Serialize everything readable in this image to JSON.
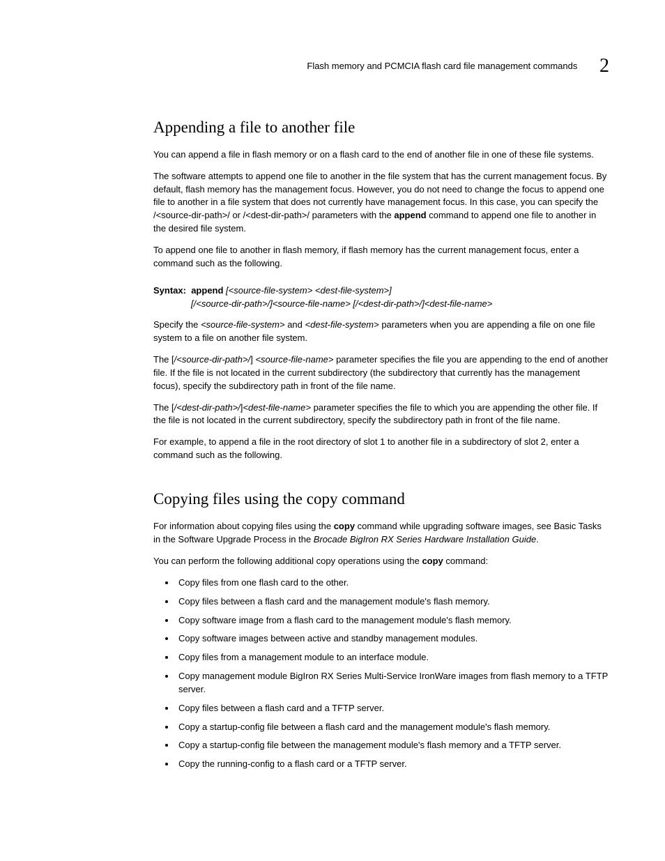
{
  "header": {
    "title": "Flash memory and PCMCIA flash card file management commands",
    "chapter": "2"
  },
  "s1": {
    "heading": "Appending a file to another file",
    "p1": "You can append a file in flash memory or on a flash card to the end of another file in one of these file systems.",
    "p2a": "The software attempts to append one file to another in the file system that has the current management focus. By default, flash memory has the management focus. However, you do not need to change the focus to append one file to another in a file system that does not currently have management focus. In this case, you can specify the /<source-dir-path>/ or /<dest-dir-path>/ parameters with the ",
    "p2b": "append",
    "p2c": " command to append one file to another in the desired file system.",
    "p3": "To append one file to another in flash memory, if flash memory has the current management focus, enter a command such as the following.",
    "syntax_label": "Syntax:",
    "syntax_cmd": "append",
    "syntax_args1": " [<source-file-system> <dest-file-system>]",
    "syntax_args2": "[/<source-dir-path>/]<source-file-name> [/<dest-dir-path>/]<dest-file-name>",
    "p4a": "Specify the ",
    "p4b": "<source-file-system>",
    "p4c": " and ",
    "p4d": "<dest-file-system>",
    "p4e": " parameters when you are appending a file on one file system to a file on another file system.",
    "p5a": "The [",
    "p5b": "/<source-dir-path>/",
    "p5c": "] ",
    "p5d": "<source-file-name>",
    "p5e": " parameter specifies the file you are appending to the end of another file. If the file is not located in the current subdirectory (the subdirectory that currently has the management focus), specify the subdirectory path in front of the file name.",
    "p6a": "The [",
    "p6b": "/<dest-dir-path>/",
    "p6c": "]",
    "p6d": "<dest-file-name>",
    "p6e": " parameter specifies the file to which you are appending the other file. If the file is not located in the current subdirectory, specify the subdirectory path in front of the file name.",
    "p7": "For example, to append a file in the root directory of slot 1 to another file in a subdirectory of slot 2, enter a command such as the following."
  },
  "s2": {
    "heading": "Copying files using the copy command",
    "p1a": "For information about copying files using the ",
    "p1b": "copy",
    "p1c": " command while upgrading software images, see Basic Tasks in the Software Upgrade Process in the ",
    "p1d": "Brocade BigIron RX Series Hardware Installation Guide",
    "p1e": ".",
    "p2a": "You can perform the following additional copy operations using the ",
    "p2b": "copy",
    "p2c": " command:",
    "bullets": [
      "Copy files from one flash card to the other.",
      "Copy files between a flash card and the management module's flash memory.",
      "Copy software image from a flash card to the management module's flash memory.",
      "Copy software images between active and standby management modules.",
      "Copy files from a management module to an interface module.",
      "Copy management module BigIron RX Series Multi-Service IronWare images from flash memory to a TFTP server.",
      "Copy files between a flash card and a TFTP server.",
      "Copy a startup-config file between a flash card and the management module's flash memory.",
      "Copy a startup-config file between the management module's flash memory and a TFTP server.",
      "Copy the running-config to a flash card or a TFTP server."
    ]
  }
}
